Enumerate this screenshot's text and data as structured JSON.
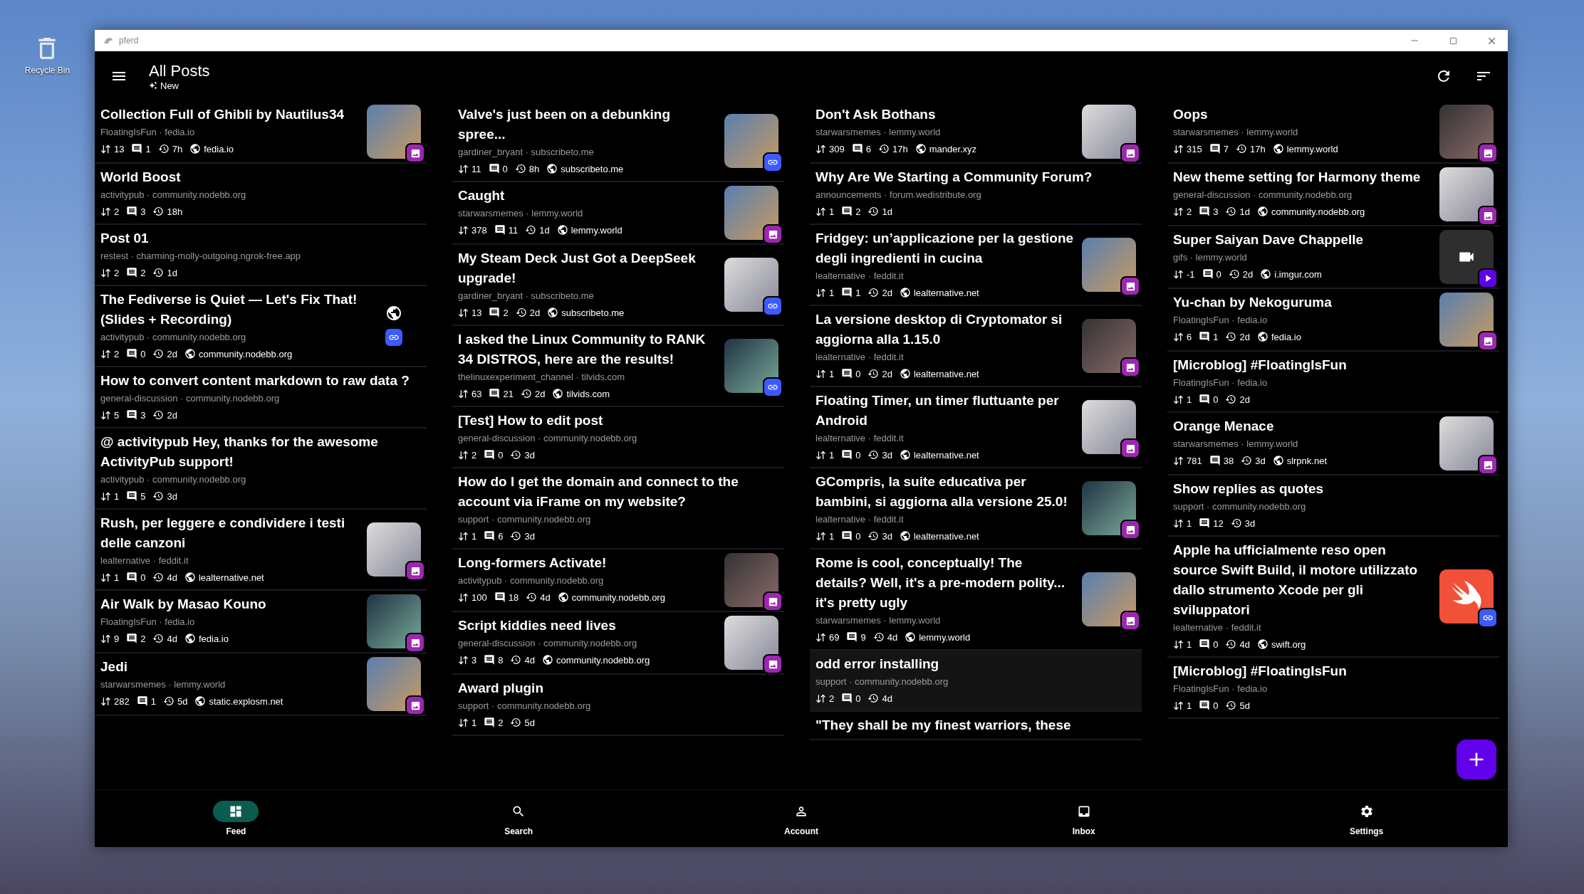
{
  "desktop": {
    "icons": [
      {
        "label": "Recycle Bin"
      }
    ]
  },
  "window": {
    "title": "pferd"
  },
  "header": {
    "title": "All Posts",
    "subtitle": "New"
  },
  "columns": [
    {
      "posts": [
        {
          "title": "Collection Full of Ghibli by Nautilus34",
          "meta": "FloatingIsFun · fedia.io",
          "score": "13",
          "comments": "1",
          "age": "7h",
          "domain": "fedia.io",
          "kind": "image",
          "highlighted": false
        },
        {
          "title": "World Boost",
          "meta": "activitypub · community.nodebb.org",
          "score": "2",
          "comments": "3",
          "age": "18h",
          "kind": "text",
          "highlighted": false
        },
        {
          "title": "Post 01",
          "meta": "restest · charming-molly-outgoing.ngrok-free.app",
          "score": "2",
          "comments": "2",
          "age": "1d",
          "kind": "text",
          "highlighted": false
        },
        {
          "title": "The Fediverse is Quiet — Let's Fix That! (Slides + Recording)",
          "meta": "activitypub · community.nodebb.org",
          "score": "2",
          "comments": "0",
          "age": "2d",
          "domain": "community.nodebb.org",
          "kind": "link_globe",
          "highlighted": false
        },
        {
          "title": "How to convert content markdown to raw data ?",
          "meta": "general-discussion · community.nodebb.org",
          "score": "5",
          "comments": "3",
          "age": "2d",
          "kind": "text",
          "highlighted": false
        },
        {
          "title": "@ activitypub  Hey, thanks for the awesome ActivityPub support!",
          "meta": "activitypub · community.nodebb.org",
          "score": "1",
          "comments": "5",
          "age": "3d",
          "kind": "text",
          "highlighted": false
        },
        {
          "title": "Rush, per leggere e condividere i testi delle canzoni",
          "meta": "lealternative · feddit.it",
          "score": "1",
          "comments": "0",
          "age": "4d",
          "domain": "lealternative.net",
          "kind": "image",
          "highlighted": false
        },
        {
          "title": "Air Walk by Masao Kouno",
          "meta": "FloatingIsFun · fedia.io",
          "score": "9",
          "comments": "2",
          "age": "4d",
          "domain": "fedia.io",
          "kind": "image",
          "highlighted": false
        },
        {
          "title": "Jedi",
          "meta": "starwarsmemes · lemmy.world",
          "score": "282",
          "comments": "1",
          "age": "5d",
          "domain": "static.explosm.net",
          "kind": "image",
          "highlighted": false
        }
      ]
    },
    {
      "posts": [
        {
          "title": "Valve's just been on a debunking spree...",
          "meta": "gardiner_bryant · subscribeto.me",
          "score": "11",
          "comments": "0",
          "age": "8h",
          "domain": "subscribeto.me",
          "kind": "link",
          "highlighted": false
        },
        {
          "title": "Caught",
          "meta": "starwarsmemes · lemmy.world",
          "score": "378",
          "comments": "11",
          "age": "1d",
          "domain": "lemmy.world",
          "kind": "image",
          "highlighted": false
        },
        {
          "title": "My Steam Deck Just Got a DeepSeek upgrade!",
          "meta": "gardiner_bryant · subscribeto.me",
          "score": "13",
          "comments": "2",
          "age": "2d",
          "domain": "subscribeto.me",
          "kind": "link",
          "highlighted": false
        },
        {
          "title": "I asked the Linux Community to RANK 34 DISTROS, here are the results!",
          "meta": "thelinuxexperiment_channel · tilvids.com",
          "score": "63",
          "comments": "21",
          "age": "2d",
          "domain": "tilvids.com",
          "kind": "link",
          "highlighted": false
        },
        {
          "title": "[Test] How to edit post",
          "meta": "general-discussion · community.nodebb.org",
          "score": "2",
          "comments": "0",
          "age": "3d",
          "kind": "text",
          "highlighted": false
        },
        {
          "title": "How do I get the domain and connect to the account via iFrame on my website?",
          "meta": "support · community.nodebb.org",
          "score": "1",
          "comments": "6",
          "age": "3d",
          "kind": "text",
          "highlighted": false
        },
        {
          "title": "Long-formers Activate!",
          "meta": "activitypub · community.nodebb.org",
          "score": "100",
          "comments": "18",
          "age": "4d",
          "domain": "community.nodebb.org",
          "kind": "image",
          "highlighted": false
        },
        {
          "title": "Script kiddies need lives",
          "meta": "general-discussion · community.nodebb.org",
          "score": "3",
          "comments": "8",
          "age": "4d",
          "domain": "community.nodebb.org",
          "kind": "image",
          "highlighted": false
        },
        {
          "title": "Award  plugin",
          "meta": "support · community.nodebb.org",
          "score": "1",
          "comments": "2",
          "age": "5d",
          "kind": "text",
          "highlighted": false
        }
      ]
    },
    {
      "posts": [
        {
          "title": "Don't Ask Bothans",
          "meta": "starwarsmemes · lemmy.world",
          "score": "309",
          "comments": "6",
          "age": "17h",
          "domain": "mander.xyz",
          "kind": "image",
          "highlighted": false
        },
        {
          "title": "Why Are We Starting a Community Forum?",
          "meta": "announcements · forum.wedistribute.org",
          "score": "1",
          "comments": "2",
          "age": "1d",
          "kind": "text",
          "highlighted": false
        },
        {
          "title": "Fridgey: un’applicazione per la gestione degli ingredienti in cucina",
          "meta": "lealternative · feddit.it",
          "score": "1",
          "comments": "1",
          "age": "2d",
          "domain": "lealternative.net",
          "kind": "image",
          "highlighted": false
        },
        {
          "title": "La versione desktop di Cryptomator si aggiorna alla 1.15.0",
          "meta": "lealternative · feddit.it",
          "score": "1",
          "comments": "0",
          "age": "2d",
          "domain": "lealternative.net",
          "kind": "image",
          "highlighted": false
        },
        {
          "title": "Floating Timer, un timer fluttuante per Android",
          "meta": "lealternative · feddit.it",
          "score": "1",
          "comments": "0",
          "age": "3d",
          "domain": "lealternative.net",
          "kind": "image",
          "highlighted": false
        },
        {
          "title": "GCompris, la suite educativa per bambini, si aggiorna alla versione 25.0!",
          "meta": "lealternative · feddit.it",
          "score": "1",
          "comments": "0",
          "age": "3d",
          "domain": "lealternative.net",
          "kind": "image",
          "highlighted": false
        },
        {
          "title": "Rome is cool, conceptually! The details? Well, it's a pre-modern polity... it's pretty ugly",
          "meta": "starwarsmemes · lemmy.world",
          "score": "69",
          "comments": "9",
          "age": "4d",
          "domain": "lemmy.world",
          "kind": "image",
          "highlighted": false
        },
        {
          "title": "odd error installing",
          "meta": "support · community.nodebb.org",
          "score": "2",
          "comments": "0",
          "age": "4d",
          "kind": "text",
          "highlighted": true
        },
        {
          "title": "\"They shall be my finest warriors, these",
          "kind": "text",
          "highlighted": false
        }
      ]
    },
    {
      "posts": [
        {
          "title": "Oops",
          "meta": "starwarsmemes · lemmy.world",
          "score": "315",
          "comments": "7",
          "age": "17h",
          "domain": "lemmy.world",
          "kind": "image",
          "highlighted": false
        },
        {
          "title": "New theme setting for Harmony theme",
          "meta": "general-discussion · community.nodebb.org",
          "score": "2",
          "comments": "3",
          "age": "1d",
          "domain": "community.nodebb.org",
          "kind": "image",
          "highlighted": false
        },
        {
          "title": "Super Saiyan Dave Chappelle",
          "meta": "gifs · lemmy.world",
          "score": "-1",
          "comments": "0",
          "age": "2d",
          "domain": "i.imgur.com",
          "kind": "video",
          "highlighted": false
        },
        {
          "title": "Yu-chan by Nekoguruma",
          "meta": "FloatingIsFun · fedia.io",
          "score": "6",
          "comments": "1",
          "age": "2d",
          "domain": "fedia.io",
          "kind": "image",
          "highlighted": false
        },
        {
          "title": "[Microblog] #FloatingIsFun",
          "meta": "FloatingIsFun · fedia.io",
          "score": "1",
          "comments": "0",
          "age": "2d",
          "kind": "text",
          "highlighted": false
        },
        {
          "title": "Orange Menace",
          "meta": "starwarsmemes · lemmy.world",
          "score": "781",
          "comments": "38",
          "age": "3d",
          "domain": "slrpnk.net",
          "kind": "image",
          "highlighted": false
        },
        {
          "title": "Show replies as quotes",
          "meta": "support · community.nodebb.org",
          "score": "1",
          "comments": "12",
          "age": "3d",
          "kind": "text",
          "highlighted": false
        },
        {
          "title": "Apple ha ufficialmente reso open source Swift Build, il motore utilizzato dallo strumento Xcode per gli sviluppatori",
          "meta": "lealternative · feddit.it",
          "score": "1",
          "comments": "0",
          "age": "4d",
          "domain": "swift.org",
          "kind": "logo_link",
          "highlighted": false
        },
        {
          "title": "[Microblog] #FloatingIsFun",
          "meta": "FloatingIsFun · fedia.io",
          "score": "1",
          "comments": "0",
          "age": "5d",
          "kind": "text",
          "highlighted": false
        }
      ]
    }
  ],
  "nav": [
    {
      "label": "Feed",
      "selected": true
    },
    {
      "label": "Search",
      "selected": false
    },
    {
      "label": "Account",
      "selected": false
    },
    {
      "label": "Inbox",
      "selected": false
    },
    {
      "label": "Settings",
      "selected": false
    }
  ]
}
